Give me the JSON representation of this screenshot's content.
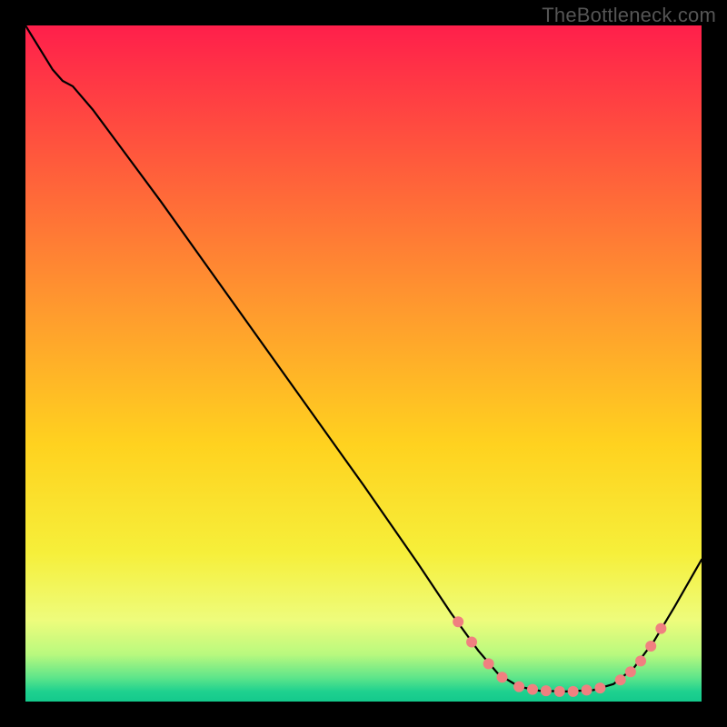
{
  "watermark": "TheBottleneck.com",
  "chart_data": {
    "type": "line",
    "title": "",
    "xlabel": "",
    "ylabel": "",
    "xlim": [
      0,
      100
    ],
    "ylim": [
      0,
      100
    ],
    "grid": false,
    "legend": false,
    "background_gradient": {
      "stops": [
        {
          "offset": 0.0,
          "color": "#ff1f4b"
        },
        {
          "offset": 0.2,
          "color": "#ff5a3c"
        },
        {
          "offset": 0.42,
          "color": "#ff9a2e"
        },
        {
          "offset": 0.62,
          "color": "#ffd21f"
        },
        {
          "offset": 0.78,
          "color": "#f6ef3a"
        },
        {
          "offset": 0.88,
          "color": "#eefc7c"
        },
        {
          "offset": 0.93,
          "color": "#b9f97e"
        },
        {
          "offset": 0.965,
          "color": "#5de58a"
        },
        {
          "offset": 0.985,
          "color": "#1fd18f"
        },
        {
          "offset": 1.0,
          "color": "#14c98c"
        }
      ]
    },
    "series": [
      {
        "name": "curve",
        "color": "#000000",
        "width": 2.2,
        "points": [
          {
            "x": 0.0,
            "y": 100.0
          },
          {
            "x": 4.0,
            "y": 93.5
          },
          {
            "x": 5.5,
            "y": 91.8
          },
          {
            "x": 7.0,
            "y": 91.0
          },
          {
            "x": 10.0,
            "y": 87.5
          },
          {
            "x": 20.0,
            "y": 74.0
          },
          {
            "x": 30.0,
            "y": 60.0
          },
          {
            "x": 40.0,
            "y": 46.0
          },
          {
            "x": 50.0,
            "y": 32.0
          },
          {
            "x": 58.0,
            "y": 20.5
          },
          {
            "x": 63.0,
            "y": 13.0
          },
          {
            "x": 67.0,
            "y": 7.5
          },
          {
            "x": 70.0,
            "y": 4.0
          },
          {
            "x": 73.0,
            "y": 2.2
          },
          {
            "x": 76.0,
            "y": 1.6
          },
          {
            "x": 80.0,
            "y": 1.5
          },
          {
            "x": 84.0,
            "y": 1.7
          },
          {
            "x": 87.0,
            "y": 2.6
          },
          {
            "x": 90.0,
            "y": 5.0
          },
          {
            "x": 93.0,
            "y": 9.0
          },
          {
            "x": 96.0,
            "y": 14.0
          },
          {
            "x": 100.0,
            "y": 21.0
          }
        ]
      }
    ],
    "markers": {
      "name": "highlight-dots",
      "color": "#f08080",
      "radius": 6,
      "points": [
        {
          "x": 64.0,
          "y": 11.8
        },
        {
          "x": 66.0,
          "y": 8.8
        },
        {
          "x": 68.5,
          "y": 5.6
        },
        {
          "x": 70.5,
          "y": 3.6
        },
        {
          "x": 73.0,
          "y": 2.2
        },
        {
          "x": 75.0,
          "y": 1.8
        },
        {
          "x": 77.0,
          "y": 1.6
        },
        {
          "x": 79.0,
          "y": 1.5
        },
        {
          "x": 81.0,
          "y": 1.5
        },
        {
          "x": 83.0,
          "y": 1.7
        },
        {
          "x": 85.0,
          "y": 2.0
        },
        {
          "x": 88.0,
          "y": 3.2
        },
        {
          "x": 89.5,
          "y": 4.4
        },
        {
          "x": 91.0,
          "y": 6.0
        },
        {
          "x": 92.5,
          "y": 8.2
        },
        {
          "x": 94.0,
          "y": 10.8
        }
      ]
    }
  }
}
